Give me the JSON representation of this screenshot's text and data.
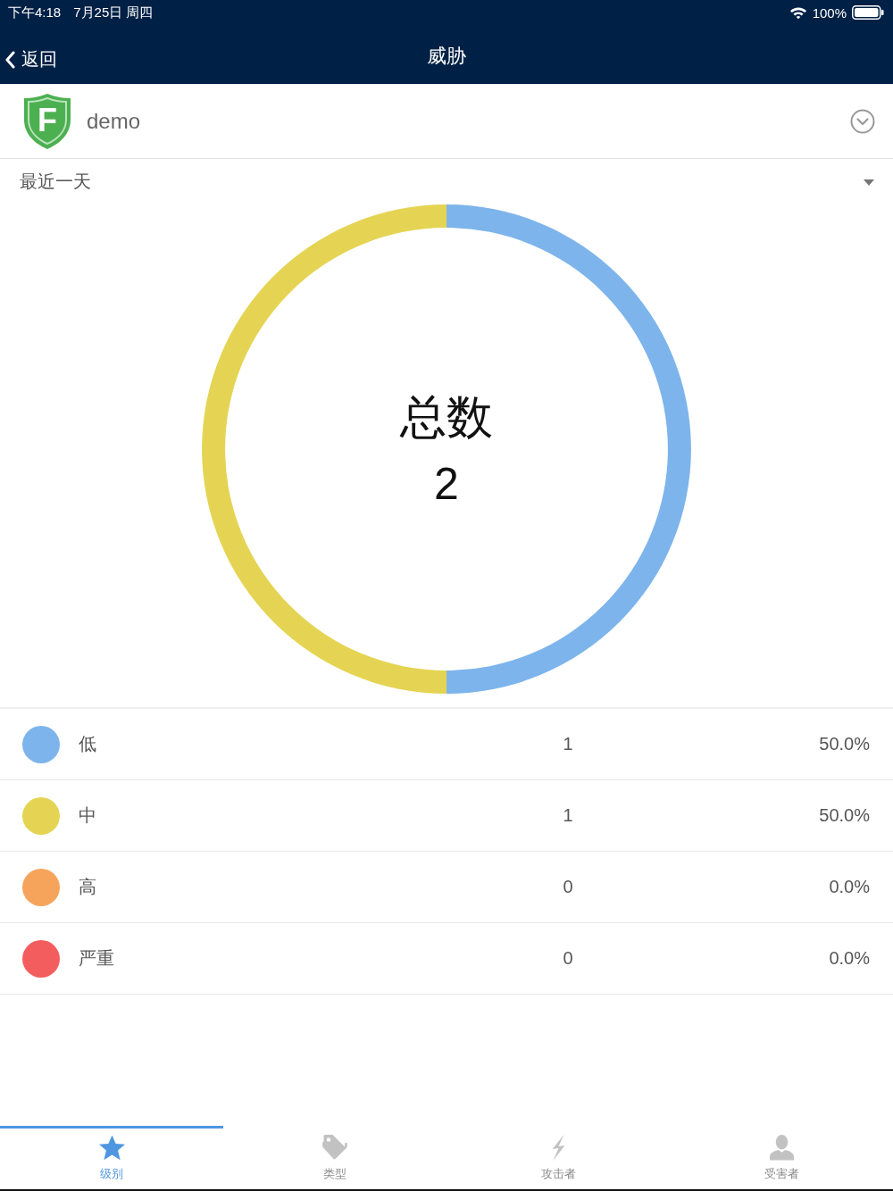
{
  "status_bar": {
    "time": "下午4:18",
    "date": "7月25日 周四",
    "battery": "100%"
  },
  "nav_bar": {
    "back": "返回",
    "title": "威胁"
  },
  "account": {
    "logo_letter": "F",
    "name": "demo"
  },
  "filter": {
    "value": "最近一天"
  },
  "chart": {
    "chart_data": {
      "type": "donut",
      "title": "总数",
      "values": [
        50.0,
        50.0,
        0.0,
        0.0
      ]
    },
    "total": "2"
  },
  "legend": [
    {
      "label": "低",
      "count": "1",
      "percent": "50.0%",
      "color": "#7db4eb"
    },
    {
      "label": "中",
      "count": "1",
      "percent": "50.0%",
      "color": "#e5d453"
    },
    {
      "label": "高",
      "count": "0",
      "percent": "0.0%",
      "color": "#f6a45c"
    },
    {
      "label": "严重",
      "count": "0",
      "percent": "0.0%",
      "color": "#f45d5d"
    }
  ],
  "tabs": [
    {
      "label": "级别",
      "selected": true
    },
    {
      "label": "类型",
      "selected": false
    },
    {
      "label": "攻击者",
      "selected": false
    },
    {
      "label": "受害者",
      "selected": false
    }
  ]
}
